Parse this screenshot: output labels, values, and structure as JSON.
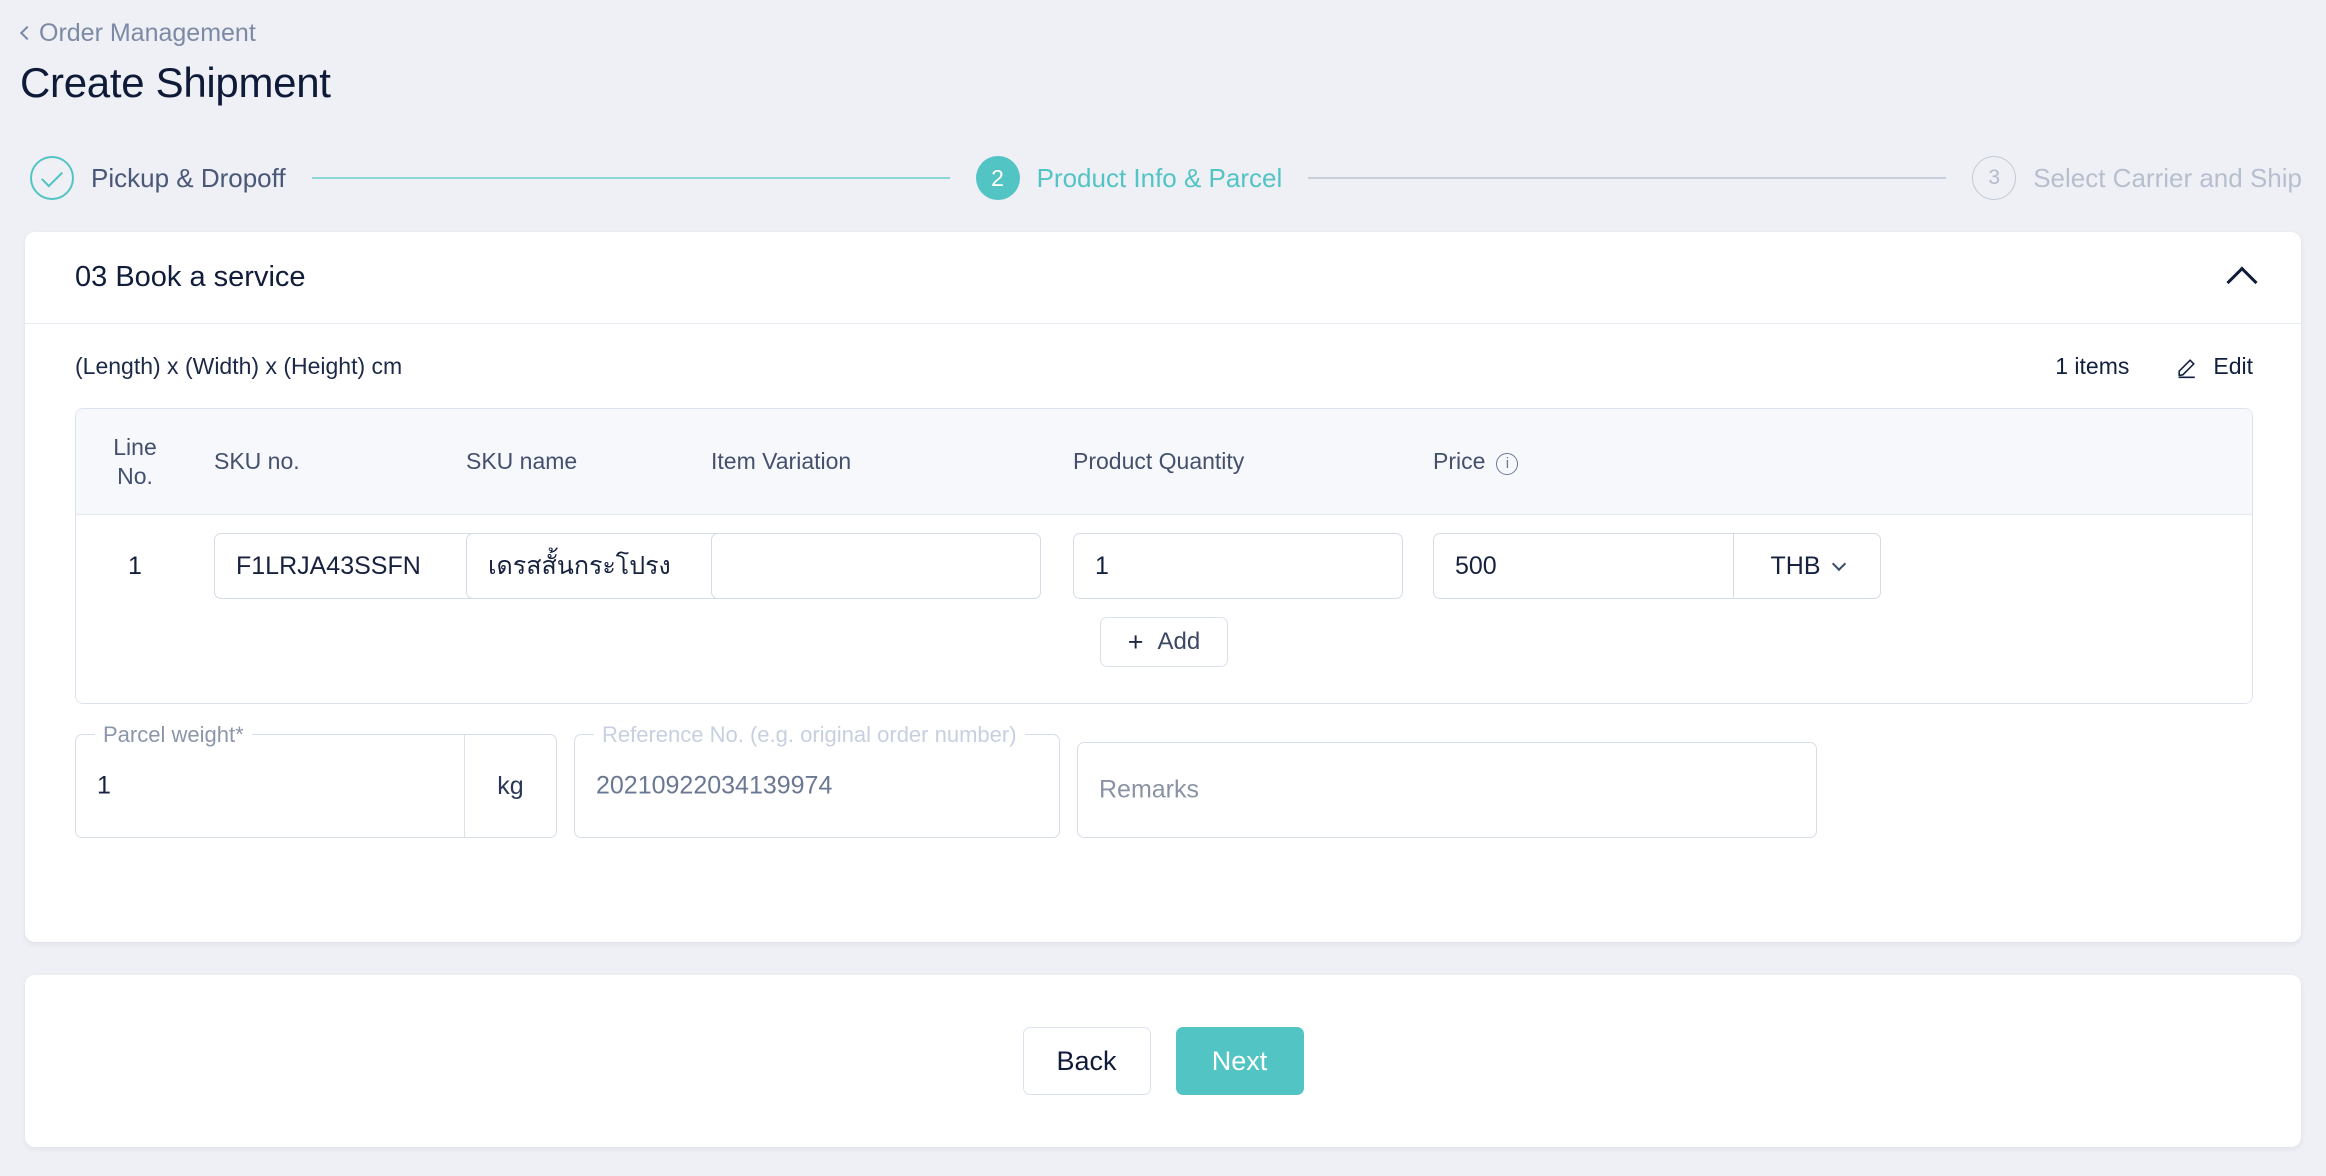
{
  "breadcrumb": {
    "label": "Order Management",
    "icon": "chevron-left-icon"
  },
  "page_title": "Create Shipment",
  "stepper": {
    "steps": [
      {
        "marker": "✓",
        "label": "Pickup & Dropoff",
        "state": "done"
      },
      {
        "marker": "2",
        "label": "Product Info & Parcel",
        "state": "active"
      },
      {
        "marker": "3",
        "label": "Select Carrier and Ship",
        "state": "todo"
      }
    ]
  },
  "card": {
    "title": "03 Book a service",
    "collapse_icon": "chevron-up-icon",
    "dims_hint": "(Length) x (Width) x (Height) cm",
    "items_count": "1 items",
    "edit_label": "Edit",
    "edit_icon": "pencil-icon"
  },
  "item_table": {
    "headers": {
      "line_no_1": "Line",
      "line_no_2": "No.",
      "sku_no": "SKU no.",
      "sku_name": "SKU name",
      "item_variation": "Item Variation",
      "product_quantity": "Product Quantity",
      "price": "Price",
      "price_info_icon": "info-icon"
    },
    "rows": [
      {
        "line_no": "1",
        "sku_no": "F1LRJA43SSFN",
        "sku_name": "เดรสสั้นกระโปรง",
        "item_variation": "",
        "product_quantity": "1",
        "price": "500",
        "currency": "THB"
      }
    ],
    "add_button": {
      "plus": "+",
      "label": "Add"
    }
  },
  "bottom_fields": {
    "parcel_weight": {
      "legend": "Parcel weight",
      "required_mark": "*",
      "value": "1",
      "unit": "kg"
    },
    "reference_no": {
      "legend": "Reference No. (e.g. original order number)",
      "value": "20210922034139974"
    },
    "remarks": {
      "placeholder": "Remarks",
      "value": ""
    }
  },
  "footer": {
    "back_label": "Back",
    "next_label": "Next"
  },
  "colors": {
    "accent_teal": "#53c4c4",
    "page_bg": "#eef0f5",
    "text_dark": "#0f1b38",
    "text_muted": "#7d8aa5",
    "border": "#d7deea"
  }
}
